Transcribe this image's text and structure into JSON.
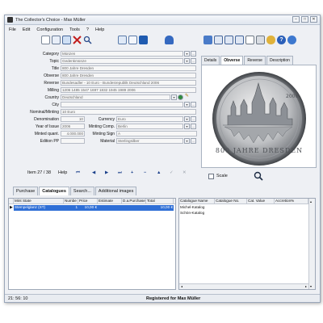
{
  "window": {
    "title": "The Collector's Choice - Max Müller",
    "controls": [
      "–",
      "□",
      "✕"
    ]
  },
  "menu": [
    "File",
    "Edit",
    "Configuration",
    "Tools",
    "?",
    "Help"
  ],
  "toolbar": {
    "left_icons": [
      "new-icon",
      "copy-icon",
      "edit-icon",
      "delete-icon",
      "search-icon",
      "list-icon",
      "table-icon",
      "book-icon",
      "bird-icon"
    ],
    "right_icons": [
      "report-icon",
      "list-report-icon",
      "list-report-icon",
      "list-report-icon",
      "print-icon",
      "print-icon",
      "coins-icon",
      "help-icon",
      "globe-icon"
    ]
  },
  "fields": {
    "category": {
      "label": "Category",
      "value": "Münzen"
    },
    "topic": {
      "label": "Topic",
      "value": "Gedenkmünze"
    },
    "title": {
      "label": "Title",
      "value": "800 Jahre Dresden"
    },
    "obverse": {
      "label": "Obverse",
      "value": "800 Jahre Dresden"
    },
    "reverse": {
      "label": "Reverse",
      "value": "Bundesadler - 10 Euro - Bundesrepublik Deutschland 2006"
    },
    "milling": {
      "label": "Milling",
      "value": "1206 1485 1547 1697 1832 1945 1989 2006"
    },
    "country": {
      "label": "Country",
      "value": "Deutschland"
    },
    "city": {
      "label": "City",
      "value": ""
    },
    "nominal_minting": {
      "label": "Nominal/Minting",
      "value": "10 Euro"
    },
    "denomination": {
      "label": "Denomination",
      "value": "10"
    },
    "currency": {
      "label": "Currency",
      "value": "Euro"
    },
    "year_of_issue": {
      "label": "Year of Issue",
      "value": "2006"
    },
    "minting_comp": {
      "label": "Minting Comp.",
      "value": "Berlin"
    },
    "minted_quant": {
      "label": "Minted quant.",
      "value": "4.000.000"
    },
    "minting_sign": {
      "label": "Minting Sign",
      "value": "A"
    },
    "edition_pp": {
      "label": "Edition PP",
      "value": ""
    },
    "material": {
      "label": "Material",
      "value": "Sterlingsilber"
    }
  },
  "navigation": {
    "item_label": "Item 27 / 38",
    "help_label": "Help",
    "buttons": [
      "first",
      "prev",
      "next",
      "last",
      "add",
      "remove",
      "up",
      "check",
      "cancel"
    ],
    "glyphs": [
      "⏮",
      "◀",
      "▶",
      "⏭",
      "+",
      "−",
      "▲",
      "✓",
      "✕"
    ]
  },
  "image_tabs": [
    "Details",
    "Obverse",
    "Reverse",
    "Description"
  ],
  "image_tabs_active": 1,
  "coin": {
    "legend": "800 JAHRE DRESDEN",
    "year": "2006"
  },
  "image_controls": {
    "scale_label": "Scale",
    "zoom_icon": "magnifier-icon"
  },
  "bottom_tabs": [
    "Purchase",
    "Catalogues",
    "Search...",
    "Additional images"
  ],
  "bottom_tabs_active": 1,
  "purchase_table": {
    "columns": [
      "Mint State",
      "Numbe",
      "Price",
      "Estimate",
      "D.a.Purchase",
      "Total"
    ],
    "rows": [
      {
        "mint_state": "Stempelglanz (ST)",
        "number": "1",
        "price": "10,00 €",
        "estimate": "",
        "date": "",
        "total": "10,00 €"
      }
    ]
  },
  "catalogue_table": {
    "columns": [
      "Catalogue Name",
      "Catalogue No.",
      "Cat. Value",
      "Accretion%"
    ],
    "rows": [
      {
        "name": "Michel-Katalog"
      },
      {
        "name": "Schön-Katalog"
      }
    ]
  },
  "status": {
    "time": "21: 56: 10",
    "registered": "Registered for Max Müller"
  },
  "colors": {
    "accent": "#1a4fb5",
    "row_select": "#2f6fd6",
    "window_bg": "#eef0f4"
  }
}
